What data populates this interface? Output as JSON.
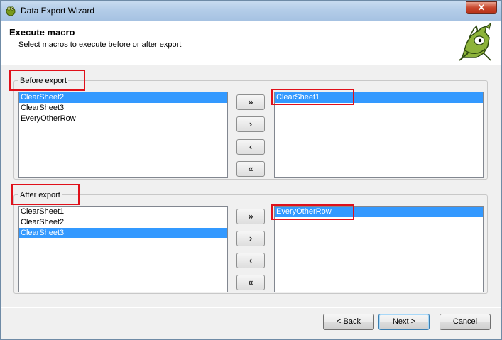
{
  "window": {
    "title": "Data Export Wizard"
  },
  "header": {
    "title": "Execute macro",
    "subtitle": "Select macros to execute before or after export"
  },
  "before": {
    "label": "Before export",
    "available": [
      {
        "label": "ClearSheet2",
        "selected": true
      },
      {
        "label": "ClearSheet3",
        "selected": false
      },
      {
        "label": "EveryOtherRow",
        "selected": false
      }
    ],
    "chosen": [
      {
        "label": "ClearSheet1",
        "selected": true
      }
    ]
  },
  "after": {
    "label": "After export",
    "available": [
      {
        "label": "ClearSheet1",
        "selected": false
      },
      {
        "label": "ClearSheet2",
        "selected": false
      },
      {
        "label": "ClearSheet3",
        "selected": true
      }
    ],
    "chosen": [
      {
        "label": "EveryOtherRow",
        "selected": true
      }
    ]
  },
  "move_buttons": {
    "add_all": "»",
    "add": "›",
    "remove": "‹",
    "remove_all": "«"
  },
  "footer": {
    "back": "< Back",
    "next": "Next >",
    "cancel": "Cancel"
  },
  "colors": {
    "selection": "#3399ff",
    "highlight_box": "#e0101a"
  },
  "icons": [
    "app-frog-icon",
    "wizard-frog-logo",
    "close-icon"
  ]
}
